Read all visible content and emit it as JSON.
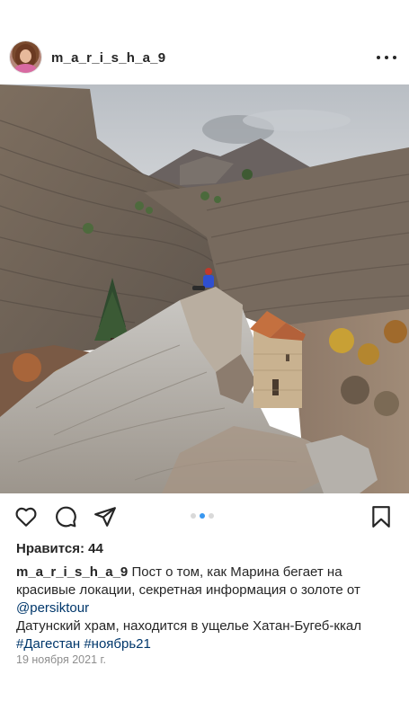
{
  "header": {
    "username": "m_a_r_i_s_h_a_9",
    "avatar_icon": "profile-avatar",
    "more_icon": "more-horizontal-icon"
  },
  "photo": {
    "icons": [
      "mountain-landscape",
      "church-building",
      "person-sitting"
    ]
  },
  "actions": {
    "like_icon": "heart-icon",
    "comment_icon": "comment-icon",
    "share_icon": "paper-plane-icon",
    "save_icon": "bookmark-icon",
    "carousel": {
      "total": 3,
      "active_index": 2
    }
  },
  "likes": {
    "label": "Нравится: 44"
  },
  "caption": {
    "username": "m_a_r_i_s_h_a_9",
    "text_part1": " Пост о том, как Марина бегает на красивые локации, секретная информация о золоте от ",
    "mention": "@persiktour",
    "line2": "Датунский храм, находится в ущелье Хатан-Бугеб-ккал",
    "hashtag1": "#Дагестан",
    "hashtag2": "#ноябрь21"
  },
  "date": "19 ноября 2021 г.",
  "colors": {
    "text": "#262626",
    "link": "#00376b",
    "muted": "#8e8e8e",
    "carousel_active": "#3897f0",
    "carousel_inactive": "#d9d9d9"
  }
}
